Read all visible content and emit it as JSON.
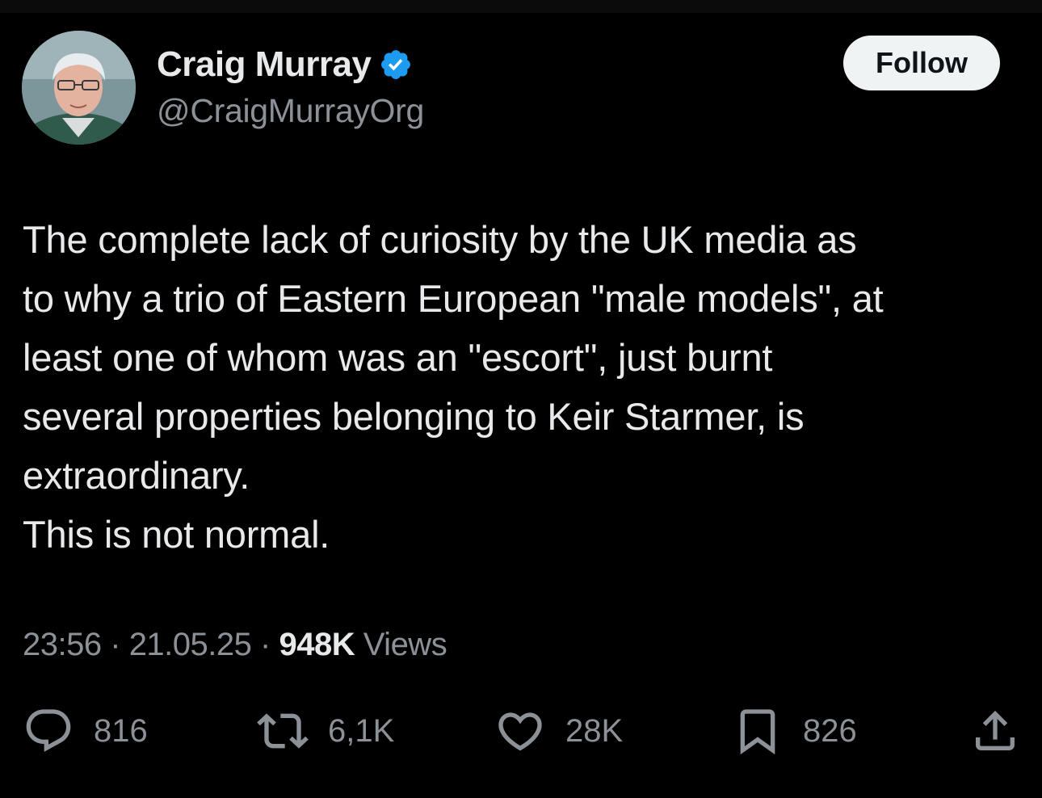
{
  "author": {
    "name": "Craig Murray",
    "handle": "@CraigMurrayOrg",
    "verified": true
  },
  "follow_label": "Follow",
  "tweet": {
    "text": "The complete lack of curiosity by the UK media as\nto why a trio of Eastern European \"male models\", at\nleast one of whom was an \"escort\", just burnt\nseveral properties belonging to Keir Starmer, is\nextraordinary.\nThis is not normal."
  },
  "meta": {
    "time": "23:56",
    "date": "21.05.25",
    "views_count": "948K",
    "views_label": "Views",
    "separator": "·"
  },
  "actions": {
    "replies": "816",
    "reposts": "6,1K",
    "likes": "28K",
    "bookmarks": "826"
  },
  "icons": {
    "verified": "verified-badge-icon",
    "reply": "reply-icon",
    "repost": "repost-icon",
    "like": "heart-icon",
    "bookmark": "bookmark-icon",
    "share": "share-icon"
  },
  "colors": {
    "background": "#000000",
    "text": "#e7e9ea",
    "secondary": "#8b9197",
    "verified": "#1d9bf0",
    "button_bg": "#eff3f4"
  }
}
